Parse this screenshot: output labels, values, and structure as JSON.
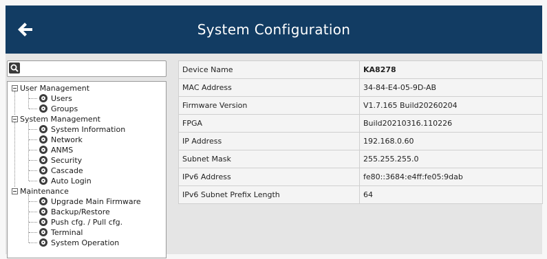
{
  "header": {
    "title": "System Configuration",
    "back_icon": "arrow-left-icon"
  },
  "search": {
    "placeholder": "",
    "icon": "search-icon"
  },
  "tree": {
    "groups": [
      {
        "label": "User Management",
        "items": [
          "Users",
          "Groups"
        ]
      },
      {
        "label": "System Management",
        "items": [
          "System Information",
          "Network",
          "ANMS",
          "Security",
          "Cascade",
          "Auto Login"
        ]
      },
      {
        "label": "Maintenance",
        "items": [
          "Upgrade Main Firmware",
          "Backup/Restore",
          "Push cfg. / Pull cfg.",
          "Terminal",
          "System Operation"
        ]
      }
    ]
  },
  "info": {
    "rows": [
      {
        "label": "Device Name",
        "value": "KA8278"
      },
      {
        "label": "MAC Address",
        "value": "34-84-E4-05-9D-AB"
      },
      {
        "label": "Firmware Version",
        "value": "V1.7.165 Build20260204"
      },
      {
        "label": "FPGA",
        "value": "Build20210316.110226"
      },
      {
        "label": "IP Address",
        "value": "192.168.0.60"
      },
      {
        "label": "Subnet Mask",
        "value": "255.255.255.0"
      },
      {
        "label": "IPv6 Address",
        "value": "fe80::3684:e4ff:fe05:9dab"
      },
      {
        "label": "IPv6 Subnet Prefix Length",
        "value": "64"
      }
    ]
  },
  "colors": {
    "header_bg": "#123c63",
    "header_text": "#ffffff",
    "panel_bg": "#e5e5e5"
  }
}
